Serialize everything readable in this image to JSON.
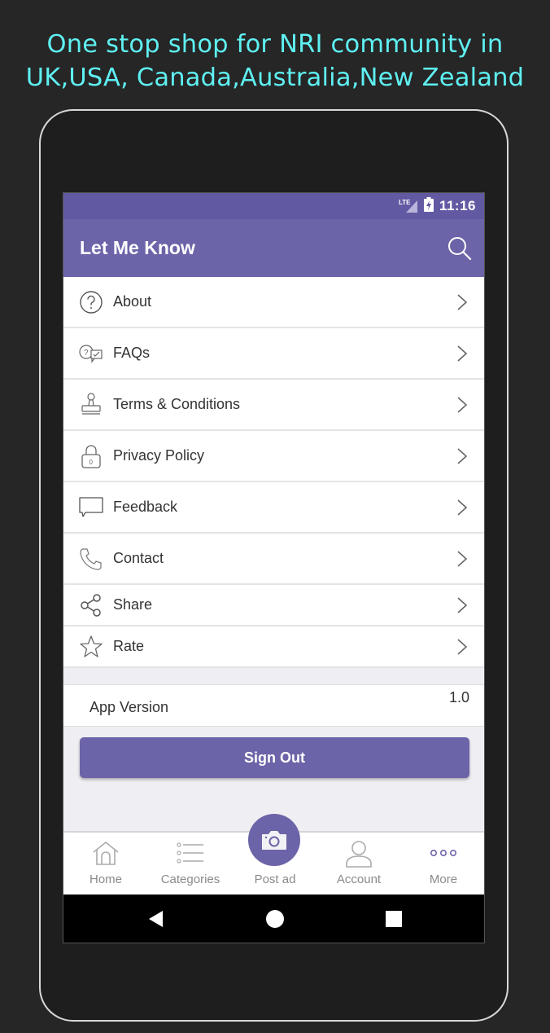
{
  "promo": {
    "line1": "One stop shop for NRI community in",
    "line2": "UK,USA, Canada,Australia,New Zealand"
  },
  "colors": {
    "promo_text": "#5ff0f2",
    "status_bar": "#6259a3",
    "app_bar": "#6c64a8",
    "accent": "#6c64a8"
  },
  "status_bar": {
    "network": "LTE",
    "battery_icon": "battery-charging-icon",
    "time": "11:16"
  },
  "app_bar": {
    "title": "Let Me Know",
    "search_icon": "search-icon"
  },
  "menu": {
    "items": [
      {
        "label": "About",
        "icon": "question-circle-icon"
      },
      {
        "label": "FAQs",
        "icon": "faq-chat-icon"
      },
      {
        "label": "Terms & Conditions",
        "icon": "stamp-icon"
      },
      {
        "label": "Privacy Policy",
        "icon": "lock-icon"
      },
      {
        "label": "Feedback",
        "icon": "speech-bubble-icon"
      },
      {
        "label": "Contact",
        "icon": "phone-icon"
      },
      {
        "label": "Share",
        "icon": "share-icon"
      },
      {
        "label": "Rate",
        "icon": "star-icon"
      }
    ]
  },
  "app_version": {
    "label": "App Version",
    "value": "1.0"
  },
  "sign_out": {
    "label": "Sign Out"
  },
  "bottom_nav": {
    "items": [
      {
        "label": "Home",
        "icon": "home-icon"
      },
      {
        "label": "Categories",
        "icon": "list-icon"
      },
      {
        "label": "Post ad",
        "icon": "camera-icon"
      },
      {
        "label": "Account",
        "icon": "person-icon"
      },
      {
        "label": "More",
        "icon": "more-dots-icon"
      }
    ]
  },
  "system_nav": {
    "back": "back-triangle-icon",
    "home": "home-circle-icon",
    "recents": "recents-square-icon"
  }
}
